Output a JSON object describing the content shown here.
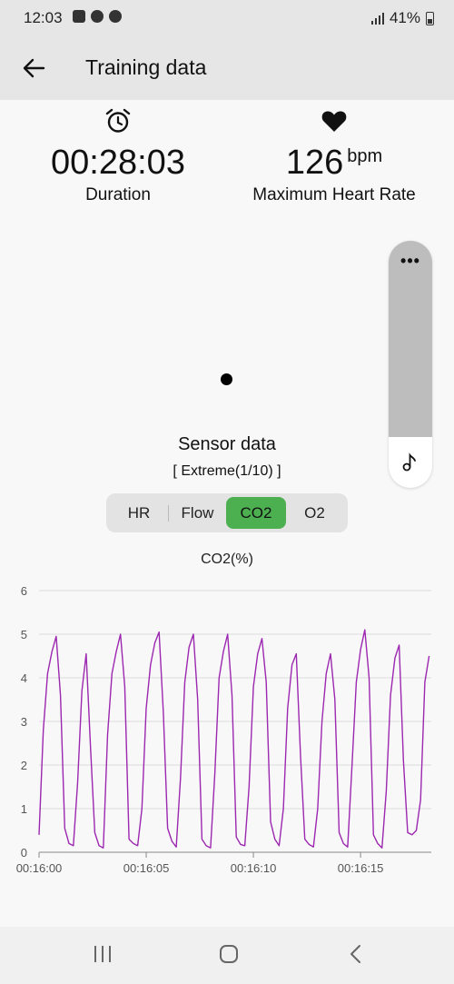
{
  "status": {
    "time": "12:03",
    "battery": "41%"
  },
  "header": {
    "title": "Training data"
  },
  "summary": {
    "duration_value": "00:28:03",
    "duration_label": "Duration",
    "hr_value": "126",
    "hr_unit": "bpm",
    "hr_label": "Maximum Heart Rate"
  },
  "sensor": {
    "title": "Sensor data",
    "subtitle": "[ Extreme(1/10) ]",
    "tabs": [
      "HR",
      "Flow",
      "CO2",
      "O2"
    ],
    "active_tab": "CO2"
  },
  "chart_data": {
    "type": "line",
    "title": "CO2(%)",
    "xlabel": "",
    "ylabel": "",
    "ylim": [
      0,
      6
    ],
    "yticks": [
      "0",
      "1",
      "2",
      "3",
      "4",
      "5",
      "6"
    ],
    "xlim_seconds": [
      960,
      978.3
    ],
    "xticks": [
      "00:16:00",
      "00:16:05",
      "00:16:10",
      "00:16:15"
    ],
    "grid": true,
    "color": "#9c27b0",
    "x": [
      960.0,
      960.2,
      960.4,
      960.6,
      960.8,
      961.0,
      961.2,
      961.4,
      961.6,
      961.8,
      962.0,
      962.2,
      962.4,
      962.6,
      962.8,
      963.0,
      963.2,
      963.4,
      963.6,
      963.8,
      964.0,
      964.2,
      964.4,
      964.6,
      964.8,
      965.0,
      965.2,
      965.4,
      965.6,
      965.8,
      966.0,
      966.2,
      966.4,
      966.6,
      966.8,
      967.0,
      967.2,
      967.4,
      967.6,
      967.8,
      968.0,
      968.2,
      968.4,
      968.6,
      968.8,
      969.0,
      969.2,
      969.4,
      969.6,
      969.8,
      970.0,
      970.2,
      970.4,
      970.6,
      970.8,
      971.0,
      971.2,
      971.4,
      971.6,
      971.8,
      972.0,
      972.2,
      972.4,
      972.6,
      972.8,
      973.0,
      973.2,
      973.4,
      973.6,
      973.8,
      974.0,
      974.2,
      974.4,
      974.6,
      974.8,
      975.0,
      975.2,
      975.4,
      975.6,
      975.8,
      976.0,
      976.2,
      976.4,
      976.6,
      976.8,
      977.0,
      977.2,
      977.4,
      977.6,
      977.8,
      978.0,
      978.2
    ],
    "y": [
      0.4,
      2.8,
      4.1,
      4.6,
      4.95,
      3.6,
      0.55,
      0.2,
      0.15,
      1.6,
      3.7,
      4.55,
      2.4,
      0.45,
      0.15,
      0.1,
      2.7,
      4.1,
      4.6,
      5.0,
      3.8,
      0.3,
      0.2,
      0.15,
      1.0,
      3.3,
      4.3,
      4.8,
      5.05,
      3.2,
      0.55,
      0.25,
      0.12,
      1.7,
      3.9,
      4.7,
      5.0,
      3.5,
      0.3,
      0.15,
      0.1,
      1.8,
      4.0,
      4.6,
      5.0,
      3.6,
      0.35,
      0.18,
      0.15,
      1.5,
      3.8,
      4.55,
      4.9,
      3.9,
      0.7,
      0.3,
      0.15,
      1.0,
      3.3,
      4.3,
      4.55,
      2.2,
      0.3,
      0.18,
      0.12,
      1.0,
      3.0,
      4.1,
      4.55,
      3.5,
      0.45,
      0.2,
      0.12,
      2.0,
      3.9,
      4.65,
      5.1,
      4.0,
      0.4,
      0.2,
      0.1,
      1.4,
      3.6,
      4.45,
      4.75,
      2.1,
      0.45,
      0.4,
      0.5,
      1.2,
      3.9,
      4.5
    ]
  },
  "nav": {
    "recents": "recents-icon",
    "home": "home-icon",
    "back": "back-icon"
  }
}
